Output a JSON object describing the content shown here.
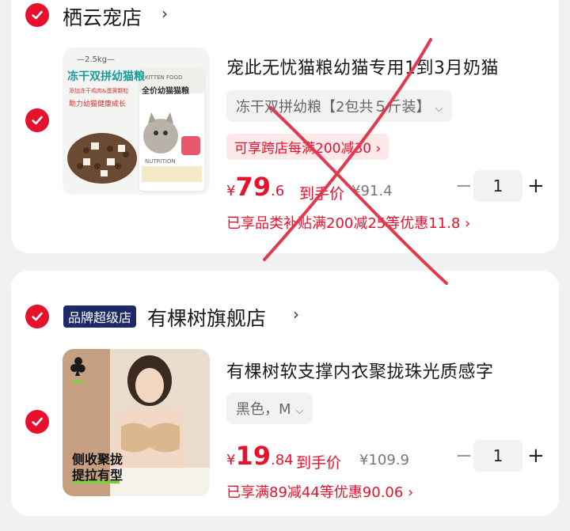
{
  "stores": [
    {
      "name": "栖云宠店",
      "badge": "",
      "product": {
        "title": "宠此无忧猫粮幼猫专用1到3月奶猫",
        "variant": "冻干双拼幼粮【2包共５斤装】",
        "promo": "可享跨店每满200减30 ›",
        "price_currency": "¥",
        "price_int": "79",
        "price_dec": ".6",
        "price_tag": "到手价",
        "original_price": "¥91.4",
        "discount": "已享品类补贴满200减25等优惠11.8 ›",
        "quantity": "1",
        "image_text": {
          "weight": "—2.5kg—",
          "line1": "冻干双拼幼猫粮",
          "line2": "添加冻干鸡肉&蛋黄颗粒",
          "line3": "助力幼猫健康成长",
          "bag_brand": "KITTEN FOOD",
          "bag_title": "全价幼猫猫粮",
          "bag_sub": "NUTRITION"
        }
      }
    },
    {
      "name": "有棵树旗舰店",
      "badge": "品牌超级店",
      "product": {
        "title": "有棵树软支撑内衣聚拢珠光质感字",
        "variant": "黑色，M",
        "promo": "",
        "price_currency": "¥",
        "price_int": "19",
        "price_dec": ".84",
        "price_tag": "到手价",
        "original_price": "¥109.9",
        "discount": "已享满89减44等优惠90.06 ›",
        "quantity": "1",
        "image_text": {
          "line1": "侧收聚拢",
          "line2": "提拉有型"
        }
      }
    }
  ],
  "icons": {
    "check": "check-circle-icon",
    "arrow": "chevron-right-icon",
    "chevron_down": "chevron-down-icon",
    "minus": "minus-icon",
    "plus": "plus-icon",
    "club": "club-icon"
  },
  "qty_minus": "−",
  "qty_plus": "+",
  "store_arrow": "›",
  "variant_chevron": "⌵",
  "colors": {
    "accent": "#e8112d",
    "badge": "#1d2a66",
    "background": "#f1f1f1",
    "cross_annotation": "#e03a4f"
  }
}
